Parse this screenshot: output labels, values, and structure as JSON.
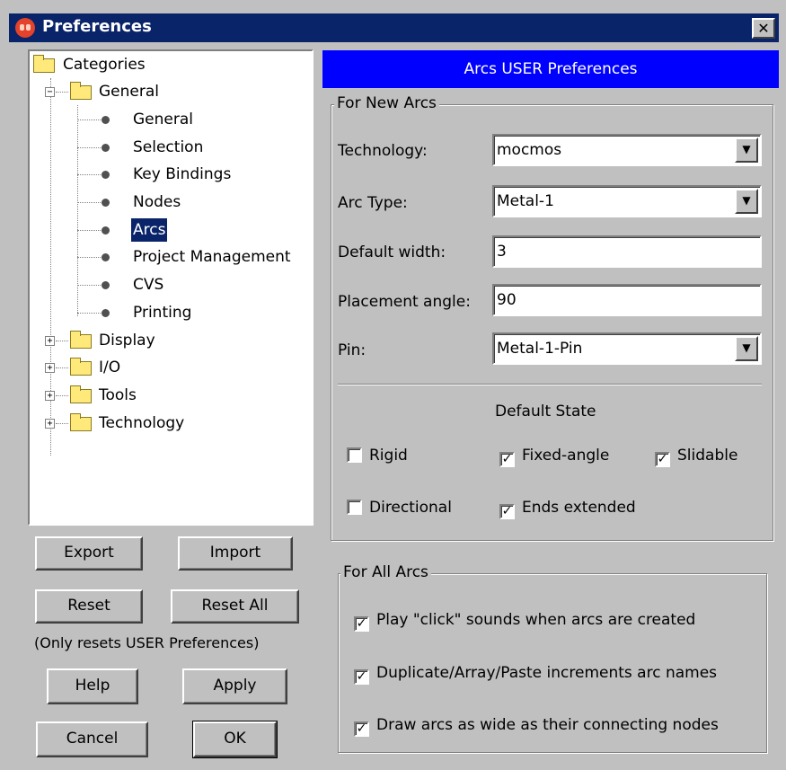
{
  "window": {
    "title": "Preferences",
    "close_label": "✕"
  },
  "tree": {
    "root": "Categories",
    "general": {
      "label": "General",
      "expander": "−",
      "children": [
        "General",
        "Selection",
        "Key Bindings",
        "Nodes",
        "Arcs",
        "Project Management",
        "CVS",
        "Printing"
      ],
      "selected": "Arcs"
    },
    "others": [
      {
        "label": "Display",
        "expander": "+"
      },
      {
        "label": "I/O",
        "expander": "+"
      },
      {
        "label": "Tools",
        "expander": "+"
      },
      {
        "label": "Technology",
        "expander": "+"
      }
    ]
  },
  "buttons": {
    "export": "Export",
    "import": "Import",
    "reset": "Reset",
    "reset_all": "Reset All",
    "reset_note": "(Only resets USER Preferences)",
    "help": "Help",
    "apply": "Apply",
    "cancel": "Cancel",
    "ok": "OK"
  },
  "panel": {
    "header": "Arcs USER Preferences",
    "new_arcs": {
      "legend": "For New Arcs",
      "technology": {
        "label": "Technology:",
        "value": "mocmos"
      },
      "arc_type": {
        "label": "Arc Type:",
        "value": "Metal-1"
      },
      "default_width": {
        "label": "Default width:",
        "value": "3"
      },
      "placement_angle": {
        "label": "Placement angle:",
        "value": "90"
      },
      "pin": {
        "label": "Pin:",
        "value": "Metal-1-Pin"
      },
      "default_state": "Default State",
      "rigid": {
        "label": "Rigid",
        "checked": false,
        "mark": ""
      },
      "fixed_angle": {
        "label": "Fixed-angle",
        "checked": true,
        "mark": "✓"
      },
      "slidable": {
        "label": "Slidable",
        "checked": true,
        "mark": "✓"
      },
      "directional": {
        "label": "Directional",
        "checked": false,
        "mark": ""
      },
      "ends_extended": {
        "label": "Ends extended",
        "checked": true,
        "mark": "✓"
      }
    },
    "all_arcs": {
      "legend": "For All Arcs",
      "click_sounds": {
        "label": "Play \"click\" sounds when arcs are created",
        "checked": true,
        "mark": "✓"
      },
      "duplicate_increments": {
        "label": "Duplicate/Array/Paste increments arc names",
        "checked": true,
        "mark": "✓"
      },
      "draw_wide": {
        "label": "Draw arcs as wide as their connecting nodes",
        "checked": true,
        "mark": "✓"
      }
    }
  },
  "icons": {
    "app": "app-icon",
    "folder": "folder-icon",
    "leaf": "leaf-dot-icon",
    "dropdown": "dropdown-arrow-icon"
  },
  "colors": {
    "titlebar": "#0a246a",
    "panel_header": "#0000ff",
    "selection": "#0a246a",
    "window_bg": "#c0c0c0"
  }
}
